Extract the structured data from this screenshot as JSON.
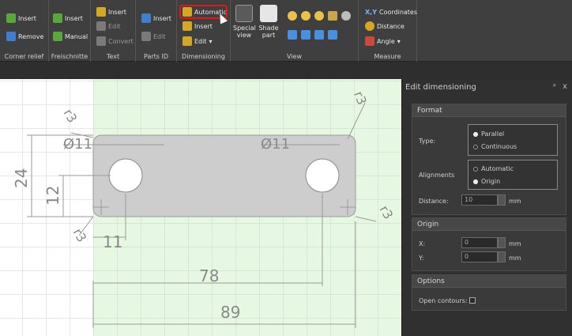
{
  "ribbon": {
    "groups": {
      "corner_relief": {
        "label": "Corner relief",
        "insert": "Insert",
        "remove": "Remove"
      },
      "freischnitte": {
        "label": "Freischnitte",
        "insert": "Insert",
        "manual": "Manual"
      },
      "text": {
        "label": "Text",
        "insert": "Insert",
        "edit": "Edit",
        "convert": "Convert"
      },
      "parts_id": {
        "label": "Parts ID",
        "insert": "Insert",
        "edit": "Edit"
      },
      "dimensioning": {
        "label": "Dimensioning",
        "automatic": "Automatic",
        "insert": "Insert",
        "edit": "Edit"
      },
      "view": {
        "label": "View",
        "special_view": "Special view",
        "shade_part": "Shade part"
      },
      "measure": {
        "label": "Measure",
        "coordinates": "Coordinates",
        "distance": "Distance",
        "angle": "Angle"
      }
    }
  },
  "drawing": {
    "dims": {
      "width_total": "89",
      "hole_spacing": "78",
      "edge_offset": "11",
      "height": "24",
      "hole_center": "12",
      "hole_dia_left": "Ø11",
      "hole_dia_right": "Ø11",
      "corner_tl": "r3",
      "corner_tr": "r3",
      "corner_bl": "r3",
      "corner_br": "r3"
    }
  },
  "panel": {
    "title": "Edit dimensioning",
    "pin": "ᵖ",
    "close": "x",
    "format": {
      "header": "Format",
      "type_label": "Type:",
      "type_options": [
        "Parallel",
        "Continuous"
      ],
      "type_selected": "Parallel",
      "align_label": "Alignments",
      "align_options": [
        "Automatic",
        "Origin"
      ],
      "align_selected": "Origin",
      "distance_label": "Distance:",
      "distance_value": "10",
      "distance_unit": "mm"
    },
    "origin": {
      "header": "Origin",
      "x_label": "X:",
      "x_value": "0",
      "x_unit": "mm",
      "y_label": "Y:",
      "y_value": "0",
      "y_unit": "mm"
    },
    "options": {
      "header": "Options",
      "open_contours_label": "Open contours:"
    }
  }
}
